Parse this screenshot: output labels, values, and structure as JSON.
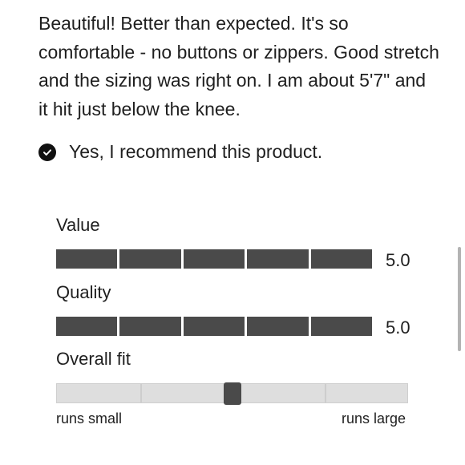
{
  "review": {
    "text": "Beautiful! Better than expected. It's so comfortable - no buttons or zippers. Good stretch and the sizing was right on. I am about 5'7\" and it hit just below the knee.",
    "recommend_text": "Yes, I recommend this product."
  },
  "ratings": [
    {
      "label": "Value",
      "value": "5.0",
      "score": 5,
      "max": 5
    },
    {
      "label": "Quality",
      "value": "5.0",
      "score": 5,
      "max": 5
    }
  ],
  "fit": {
    "label": "Overall fit",
    "min_label": "runs small",
    "max_label": "runs large",
    "position_fraction": 0.5
  },
  "colors": {
    "filled_segment": "#4a4a4a",
    "empty_segment": "#d9d9d9",
    "text": "#1f1f1f"
  },
  "icons": {
    "recommend": "check-circle-icon"
  }
}
